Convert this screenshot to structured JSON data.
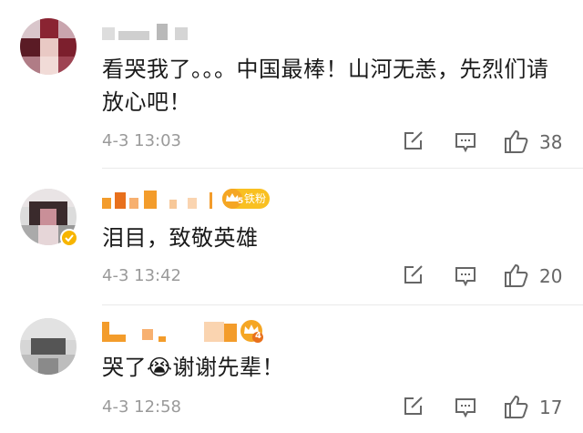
{
  "comments": [
    {
      "text": "看哭我了。。。中国最棒！山河无恙，先烈们请放心吧！",
      "time": "4-3 13:03",
      "likes": "38"
    },
    {
      "text": "泪目，致敬英雄",
      "time": "4-3 13:42",
      "likes": "20",
      "badge_label": "铁粉",
      "badge_level": "5"
    },
    {
      "text": "哭了😭谢谢先辈！",
      "time": "4-3 12:58",
      "likes": "17",
      "badge_level": "4"
    }
  ],
  "colors": {
    "orange": "#f39c2b",
    "badge": "#f7b500",
    "gray": "#9a9a9a"
  },
  "icons": [
    "share-icon",
    "comment-icon",
    "like-icon"
  ]
}
